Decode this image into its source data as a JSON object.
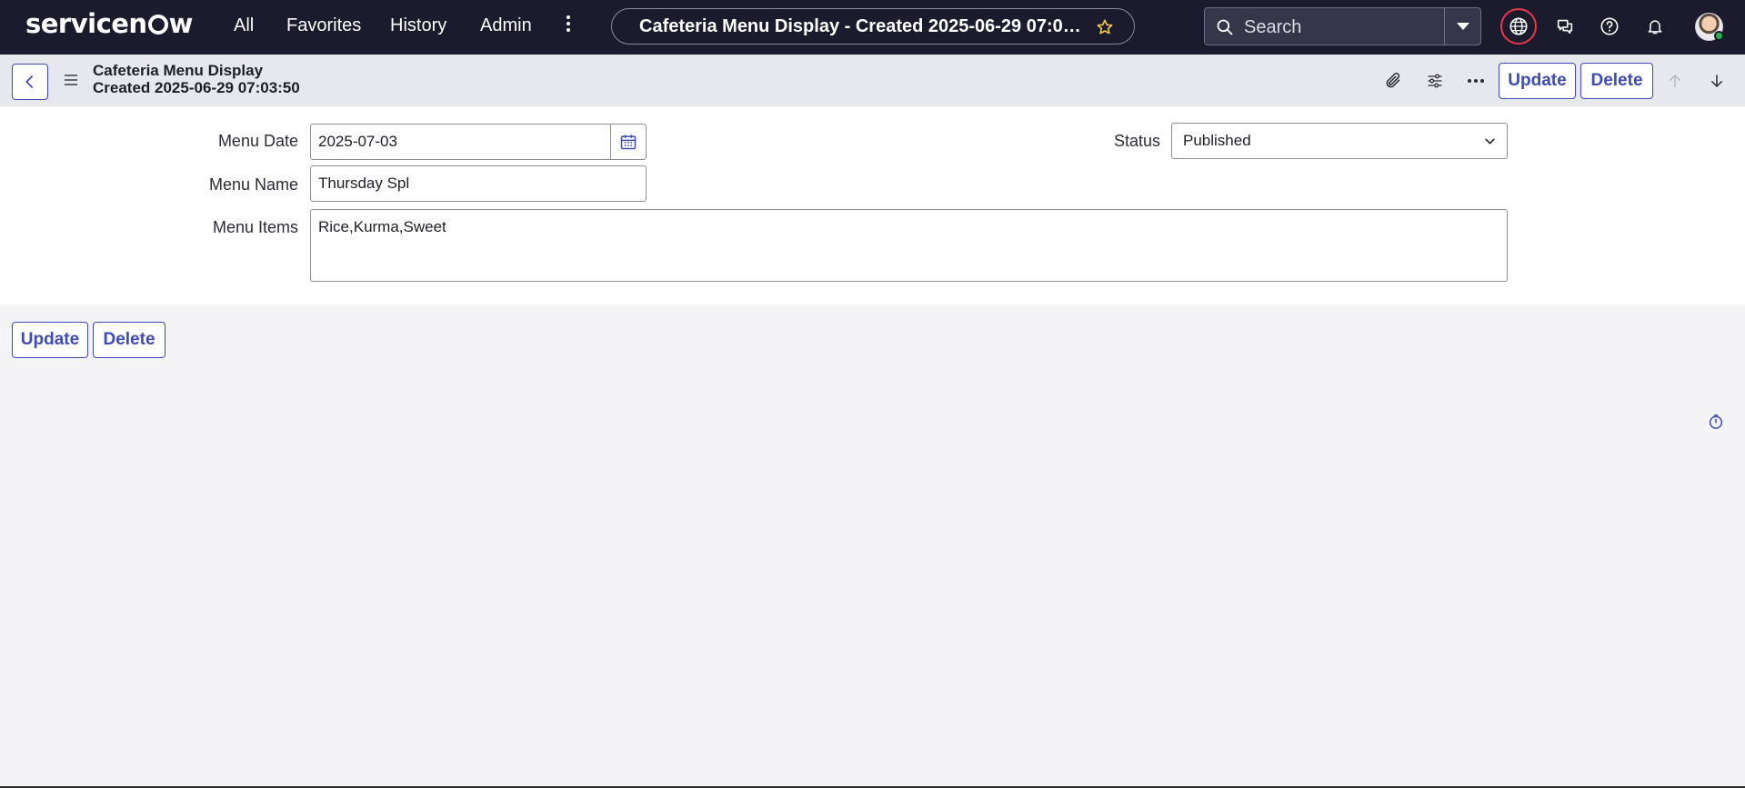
{
  "brand": {
    "logo_text_pre": "servicen",
    "logo_text_post": "w"
  },
  "nav": {
    "items": [
      {
        "label": "All"
      },
      {
        "label": "Favorites"
      },
      {
        "label": "History"
      },
      {
        "label": "Admin"
      }
    ],
    "record_title": "Cafeteria Menu Display - Created 2025-06-29 07:03:50",
    "search_placeholder": "Search",
    "icons": [
      "more-vertical-icon",
      "star-icon",
      "search-icon",
      "chevron-down-icon",
      "globe-icon",
      "chat-icon",
      "help-icon",
      "bell-icon",
      "avatar"
    ]
  },
  "record_header": {
    "table_name": "Cafeteria Menu Display",
    "created_label": "Created 2025-06-29 07:03:50",
    "update_label": "Update",
    "delete_label": "Delete",
    "icons": [
      "back-icon",
      "hamburger-icon",
      "paperclip-icon",
      "sliders-icon",
      "more-horizontal-icon",
      "arrow-up-icon",
      "arrow-down-icon"
    ]
  },
  "form": {
    "menu_date": {
      "label": "Menu Date",
      "value": "2025-07-03"
    },
    "menu_name": {
      "label": "Menu Name",
      "value": "Thursday Spl"
    },
    "menu_items": {
      "label": "Menu Items",
      "value": "Rice,Kurma,Sweet"
    },
    "status": {
      "label": "Status",
      "value": "Published"
    }
  },
  "bottom_actions": {
    "update_label": "Update",
    "delete_label": "Delete"
  },
  "colors": {
    "nav_bg": "#1b1b2d",
    "accent": "#3e4bb5",
    "globe_ring": "#e5394b",
    "star": "#f2c94c"
  }
}
